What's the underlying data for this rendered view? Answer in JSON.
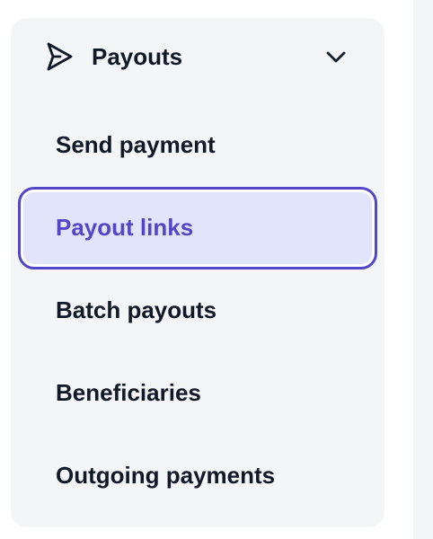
{
  "sidebar": {
    "section": {
      "title": "Payouts",
      "icon": "send-icon",
      "toggle_icon": "chevron-down-icon",
      "expanded": true
    },
    "items": [
      {
        "label": "Send payment",
        "active": false
      },
      {
        "label": "Payout links",
        "active": true
      },
      {
        "label": "Batch payouts",
        "active": false
      },
      {
        "label": "Beneficiaries",
        "active": false
      },
      {
        "label": "Outgoing payments",
        "active": false
      }
    ]
  },
  "colors": {
    "panel_background": "#f4f5f7",
    "active_background": "#e1e4fb",
    "active_border": "#5346c8",
    "active_text": "#5545c7",
    "text": "#111827"
  }
}
